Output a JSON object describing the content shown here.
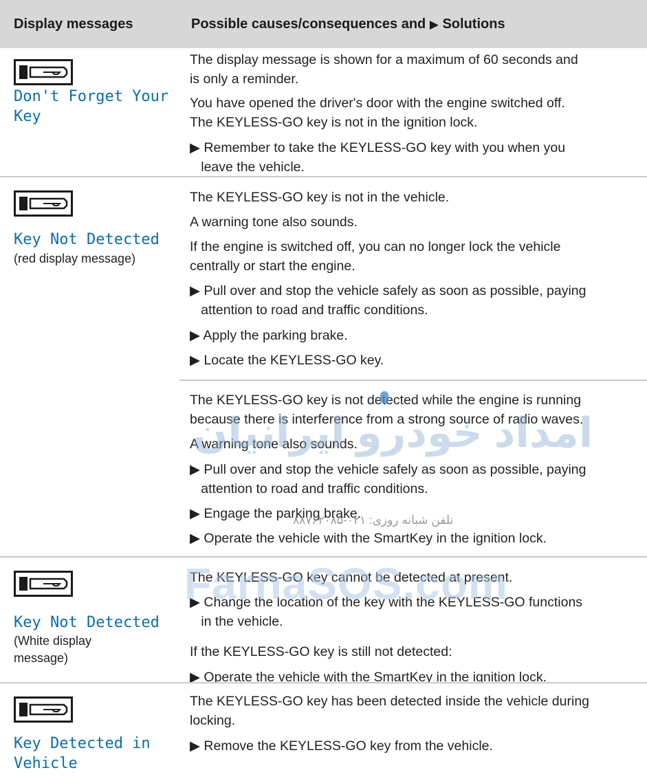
{
  "header": {
    "col1": "Display messages",
    "col2_before": "Possible causes/consequences and ",
    "col2_arrow": "▶",
    "col2_after": " Solutions"
  },
  "rows": [
    {
      "icon": "key-icon",
      "title_line1": "Don't Forget Your",
      "title_line2": "Key",
      "p1": "The display message is shown for a maximum of 60 seconds and",
      "p2": "is only a reminder.",
      "p3": "You have opened the driver's door with the engine switched off.",
      "p4": "The KEYLESS-GO key is not in the ignition lock.",
      "b1": "▶ Remember to take the KEYLESS-GO key with you when you",
      "b1b": "   leave the vehicle."
    },
    {
      "icon": "key-icon",
      "title": "Key Not Detected",
      "sub": "(red display message)",
      "p1": "The KEYLESS-GO key is not in the vehicle.",
      "p2": "A warning tone also sounds.",
      "p3": "If the engine is switched off, you can no longer lock the vehicle",
      "p4": "centrally or start the engine.",
      "b1": "▶ Pull over and stop the vehicle safely as soon as possible, paying",
      "b1b": "   attention to road and traffic conditions.",
      "b2": "▶ Apply the parking brake.",
      "b3": "▶ Locate the KEYLESS-GO key.",
      "q1": "The KEYLESS-GO key is not detected while the engine is running",
      "q2": "because there is interference from a strong source of radio waves.",
      "q3": "A warning tone also sounds.",
      "c1": "▶ Pull over and stop the vehicle safely as soon as possible, paying",
      "c1b": "   attention to road and traffic conditions.",
      "c2": "▶ Engage the parking brake.",
      "c3": "▶ Operate the vehicle with the SmartKey in the ignition lock."
    },
    {
      "icon": "key-icon",
      "title": "Key Not Detected",
      "sub1": "(White display",
      "sub2": "message)",
      "p1": "The KEYLESS-GO key cannot be detected at present.",
      "b1": "▶ Change the location of the key with the KEYLESS-GO functions",
      "b1b": "   in the vehicle.",
      "p2": "If the KEYLESS-GO key is still not detected:",
      "b2": "▶ Operate the vehicle with the SmartKey in the ignition lock."
    },
    {
      "icon": "key-icon",
      "title_line1": "Key Detected in",
      "title_line2": "Vehicle",
      "p1": "The KEYLESS-GO key has been detected inside the vehicle during",
      "p2": "locking.",
      "b1": "▶ Remove the KEYLESS-GO key from the vehicle."
    }
  ],
  "watermark": {
    "arabic": "امداد خودرو ایرانیان",
    "phone": "تلفن شبانه روزی: ۰۲۱-۸۸۷۶۲۰۸۵",
    "site": "FarnaSOS.com"
  },
  "colors": {
    "header_bg": "#d7d7d7",
    "title_blue": "#0a6ea8",
    "rule": "#c9c9c9"
  }
}
